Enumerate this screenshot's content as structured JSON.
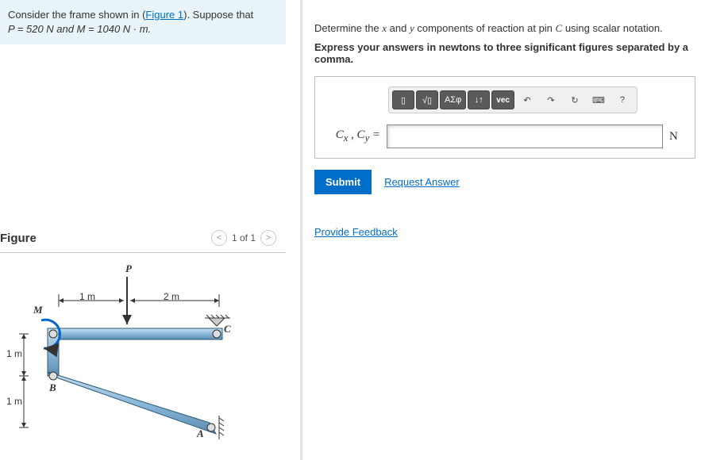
{
  "problem": {
    "text_prefix": "Consider the frame shown in (",
    "figure_link": "Figure 1",
    "text_suffix": "). Suppose that",
    "values_line": "P = 520 N and M = 1040 N · m."
  },
  "figure": {
    "title": "Figure",
    "pager": "1 of 1",
    "labels": {
      "P": "P",
      "M": "M",
      "A": "A",
      "B": "B",
      "C": "C",
      "d1m_a": "1 m",
      "d1m_b": "1 m",
      "d1m_c": "1 m",
      "d2m": "2 m"
    }
  },
  "question": {
    "prompt1_pre": "Determine the ",
    "prompt1_x": "x",
    "prompt1_mid": " and ",
    "prompt1_y": "y",
    "prompt1_post": " components of reaction at pin ",
    "prompt1_c": "C",
    "prompt1_end": " using scalar notation.",
    "prompt2": "Express your answers in newtons to three significant figures separated by a comma.",
    "var_label": "Cₓ , C_y =",
    "unit": "N",
    "submit": "Submit",
    "request": "Request Answer"
  },
  "toolbar": {
    "templates": "▯",
    "fraction": "√▯",
    "greek": "ΑΣφ",
    "subscript": "↓↑",
    "vector": "vec",
    "undo": "↶",
    "redo": "↷",
    "reset": "↻",
    "keyboard": "⌨",
    "help": "?"
  },
  "feedback": "Provide Feedback"
}
